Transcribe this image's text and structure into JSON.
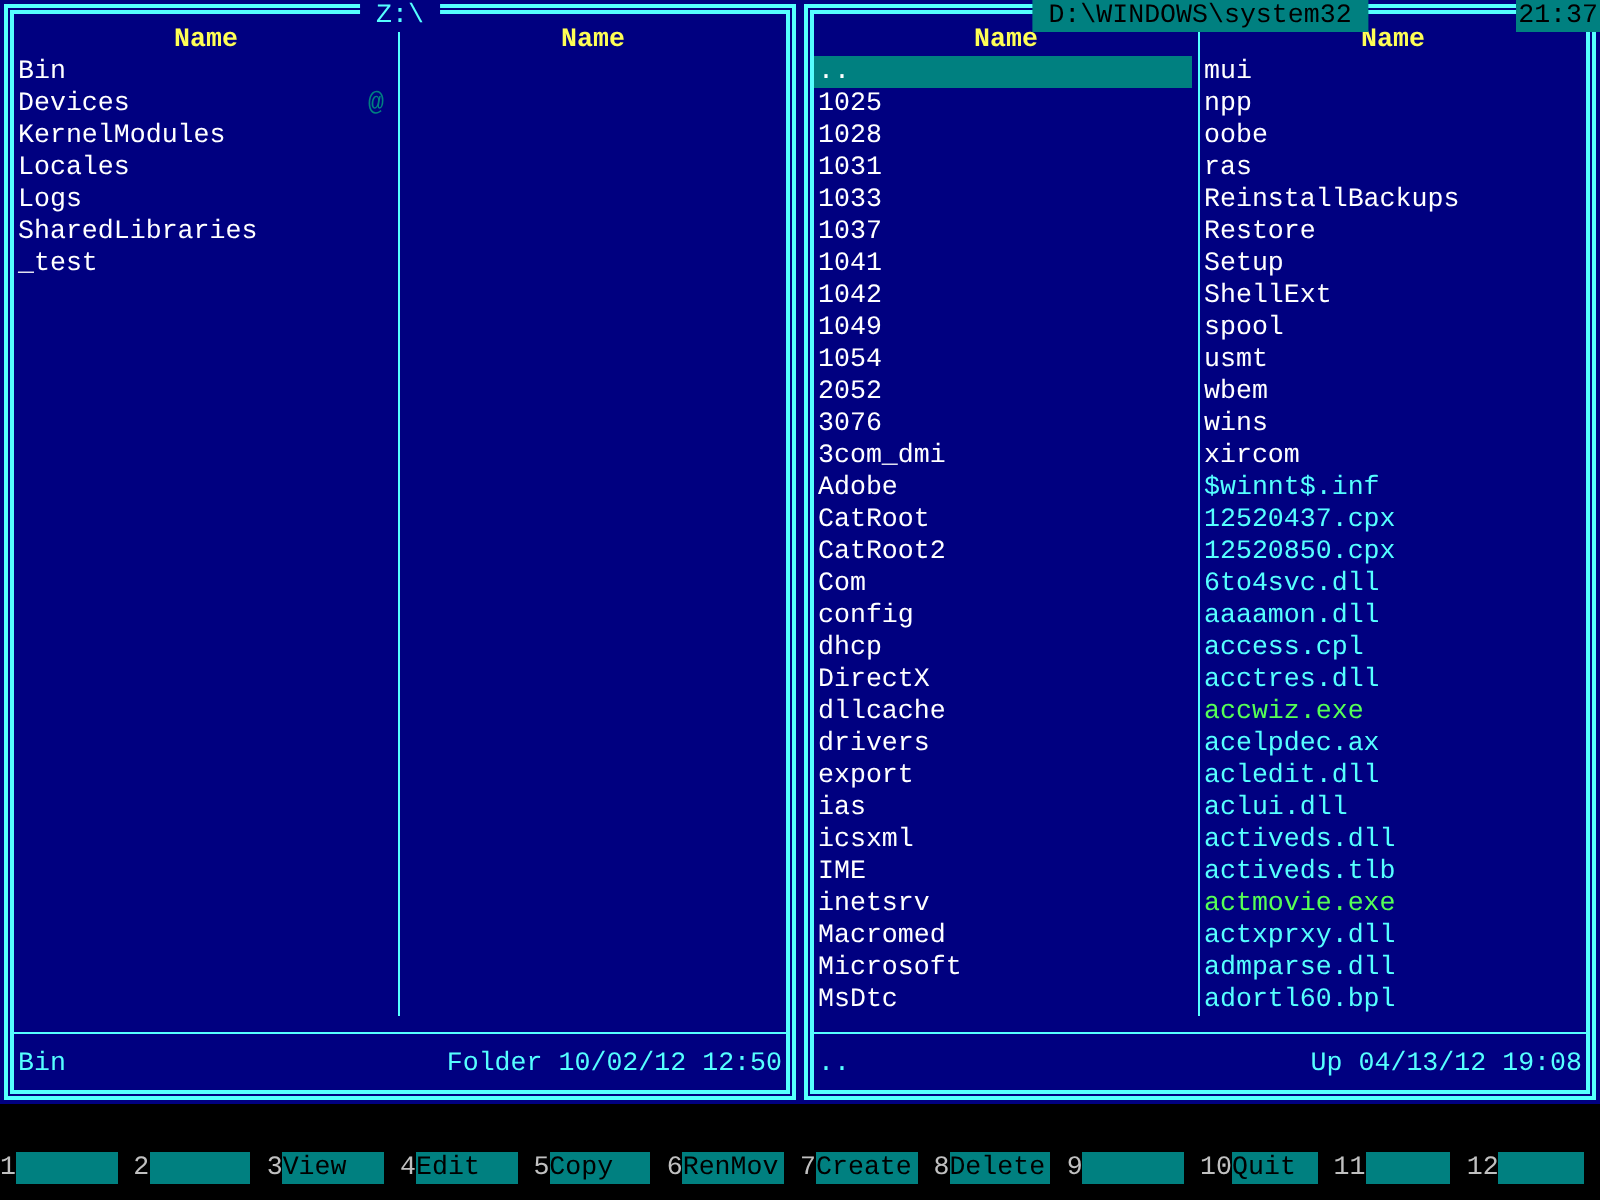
{
  "clock": "21:37",
  "panels": [
    {
      "path": "Z:\\",
      "active": false,
      "columns": [
        {
          "header": "Name",
          "files": [
            {
              "name": "Bin",
              "kind": "folder",
              "selected": false
            },
            {
              "name": "Devices",
              "kind": "folder",
              "selected": false,
              "mark": "@"
            },
            {
              "name": "KernelModules",
              "kind": "folder",
              "selected": false
            },
            {
              "name": "Locales",
              "kind": "folder",
              "selected": false
            },
            {
              "name": "Logs",
              "kind": "folder",
              "selected": false
            },
            {
              "name": "SharedLibraries",
              "kind": "folder",
              "selected": false
            },
            {
              "name": "_test",
              "kind": "folder",
              "selected": false
            }
          ]
        },
        {
          "header": "Name"
        }
      ],
      "status": {
        "name": "Bin",
        "type_label": "Folder",
        "date": "10/02/12",
        "time": "12:50"
      }
    },
    {
      "path": "D:\\WINDOWS\\system32",
      "active": true,
      "columns": [
        {
          "header": "Name",
          "files": [
            {
              "name": "..",
              "kind": "folder",
              "selected": true
            },
            {
              "name": "1025",
              "kind": "folder",
              "selected": false
            },
            {
              "name": "1028",
              "kind": "folder",
              "selected": false
            },
            {
              "name": "1031",
              "kind": "folder",
              "selected": false
            },
            {
              "name": "1033",
              "kind": "folder",
              "selected": false
            },
            {
              "name": "1037",
              "kind": "folder",
              "selected": false
            },
            {
              "name": "1041",
              "kind": "folder",
              "selected": false
            },
            {
              "name": "1042",
              "kind": "folder",
              "selected": false
            },
            {
              "name": "1049",
              "kind": "folder",
              "selected": false
            },
            {
              "name": "1054",
              "kind": "folder",
              "selected": false
            },
            {
              "name": "2052",
              "kind": "folder",
              "selected": false
            },
            {
              "name": "3076",
              "kind": "folder",
              "selected": false
            },
            {
              "name": "3com_dmi",
              "kind": "folder",
              "selected": false
            },
            {
              "name": "Adobe",
              "kind": "folder",
              "selected": false
            },
            {
              "name": "CatRoot",
              "kind": "folder",
              "selected": false
            },
            {
              "name": "CatRoot2",
              "kind": "folder",
              "selected": false
            },
            {
              "name": "Com",
              "kind": "folder",
              "selected": false
            },
            {
              "name": "config",
              "kind": "folder",
              "selected": false
            },
            {
              "name": "dhcp",
              "kind": "folder",
              "selected": false
            },
            {
              "name": "DirectX",
              "kind": "folder",
              "selected": false
            },
            {
              "name": "dllcache",
              "kind": "folder",
              "selected": false
            },
            {
              "name": "drivers",
              "kind": "folder",
              "selected": false
            },
            {
              "name": "export",
              "kind": "folder",
              "selected": false
            },
            {
              "name": "ias",
              "kind": "folder",
              "selected": false
            },
            {
              "name": "icsxml",
              "kind": "folder",
              "selected": false
            },
            {
              "name": "IME",
              "kind": "folder",
              "selected": false
            },
            {
              "name": "inetsrv",
              "kind": "folder",
              "selected": false
            },
            {
              "name": "Macromed",
              "kind": "folder",
              "selected": false
            },
            {
              "name": "Microsoft",
              "kind": "folder",
              "selected": false
            },
            {
              "name": "MsDtc",
              "kind": "folder",
              "selected": false
            }
          ]
        },
        {
          "header": "Name",
          "files": [
            {
              "name": "mui",
              "kind": "folder",
              "selected": false
            },
            {
              "name": "npp",
              "kind": "folder",
              "selected": false
            },
            {
              "name": "oobe",
              "kind": "folder",
              "selected": false
            },
            {
              "name": "ras",
              "kind": "folder",
              "selected": false
            },
            {
              "name": "ReinstallBackups",
              "kind": "folder",
              "selected": false
            },
            {
              "name": "Restore",
              "kind": "folder",
              "selected": false
            },
            {
              "name": "Setup",
              "kind": "folder",
              "selected": false
            },
            {
              "name": "ShellExt",
              "kind": "folder",
              "selected": false
            },
            {
              "name": "spool",
              "kind": "folder",
              "selected": false
            },
            {
              "name": "usmt",
              "kind": "folder",
              "selected": false
            },
            {
              "name": "wbem",
              "kind": "folder",
              "selected": false
            },
            {
              "name": "wins",
              "kind": "folder",
              "selected": false
            },
            {
              "name": "xircom",
              "kind": "folder",
              "selected": false
            },
            {
              "name": "$winnt$.inf",
              "kind": "file",
              "selected": false
            },
            {
              "name": "12520437.cpx",
              "kind": "file",
              "selected": false
            },
            {
              "name": "12520850.cpx",
              "kind": "file",
              "selected": false
            },
            {
              "name": "6to4svc.dll",
              "kind": "file",
              "selected": false
            },
            {
              "name": "aaaamon.dll",
              "kind": "file",
              "selected": false
            },
            {
              "name": "access.cpl",
              "kind": "file",
              "selected": false
            },
            {
              "name": "acctres.dll",
              "kind": "file",
              "selected": false
            },
            {
              "name": "accwiz.exe",
              "kind": "executable",
              "selected": false
            },
            {
              "name": "acelpdec.ax",
              "kind": "file",
              "selected": false
            },
            {
              "name": "acledit.dll",
              "kind": "file",
              "selected": false
            },
            {
              "name": "aclui.dll",
              "kind": "file",
              "selected": false
            },
            {
              "name": "activeds.dll",
              "kind": "file",
              "selected": false
            },
            {
              "name": "activeds.tlb",
              "kind": "file",
              "selected": false
            },
            {
              "name": "actmovie.exe",
              "kind": "executable",
              "selected": false
            },
            {
              "name": "actxprxy.dll",
              "kind": "file",
              "selected": false
            },
            {
              "name": "admparse.dll",
              "kind": "file",
              "selected": false
            },
            {
              "name": "adortl60.bpl",
              "kind": "file",
              "selected": false
            }
          ]
        }
      ],
      "status": {
        "name": "..",
        "type_label": "Up",
        "date": "04/13/12",
        "time": "19:08"
      }
    }
  ],
  "function_keys": [
    {
      "number": "1"
    },
    {
      "number": "2"
    },
    {
      "number": "3",
      "label": "View"
    },
    {
      "number": "4",
      "label": "Edit"
    },
    {
      "number": "5",
      "label": "Copy"
    },
    {
      "number": "6",
      "label": "RenMov"
    },
    {
      "number": "7",
      "label": "Create"
    },
    {
      "number": "8",
      "label": "Delete"
    },
    {
      "number": "9"
    },
    {
      "number": "10",
      "label": "Quit"
    },
    {
      "number": "11"
    },
    {
      "number": "12"
    }
  ]
}
